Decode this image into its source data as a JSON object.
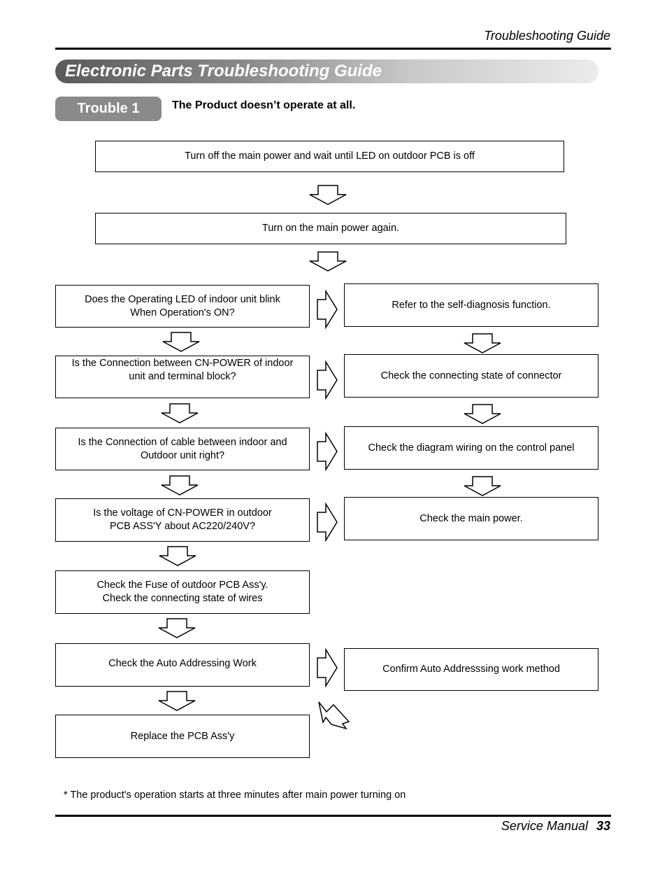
{
  "header": {
    "section_title": "Troubleshooting Guide"
  },
  "banner": {
    "title": "Electronic Parts Troubleshooting Guide"
  },
  "trouble": {
    "badge": "Trouble 1",
    "title": "The Product doesn’t operate at all."
  },
  "flow": {
    "top_steps": [
      "Turn off the main power and wait until LED on outdoor PCB is off",
      "Turn on the main power again."
    ],
    "left_steps": [
      [
        "Does the Operating LED of indoor unit blink",
        "When Operation's ON?"
      ],
      [
        "Is the Connection between CN-POWER of indoor",
        "unit and terminal block?"
      ],
      [
        "Is the Connection of cable between indoor and",
        "Outdoor unit right?"
      ],
      [
        "Is the voltage of CN-POWER in outdoor",
        "PCB ASS'Y about AC220/240V?"
      ],
      [
        "Check the Fuse of outdoor PCB Ass'y.",
        "Check the connecting state of wires"
      ],
      [
        "Check the Auto Addressing Work"
      ],
      [
        "Replace the PCB Ass'y"
      ]
    ],
    "right_steps": [
      "Refer to the self-diagnosis function.",
      "Check the connecting state of connector",
      "Check the diagram wiring on the control panel",
      "Check the main power.",
      "Confirm Auto Addresssing work method"
    ]
  },
  "footnote": "* The product's operation starts at three minutes after main power turning on",
  "footer": {
    "label": "Service Manual",
    "page": "33"
  }
}
